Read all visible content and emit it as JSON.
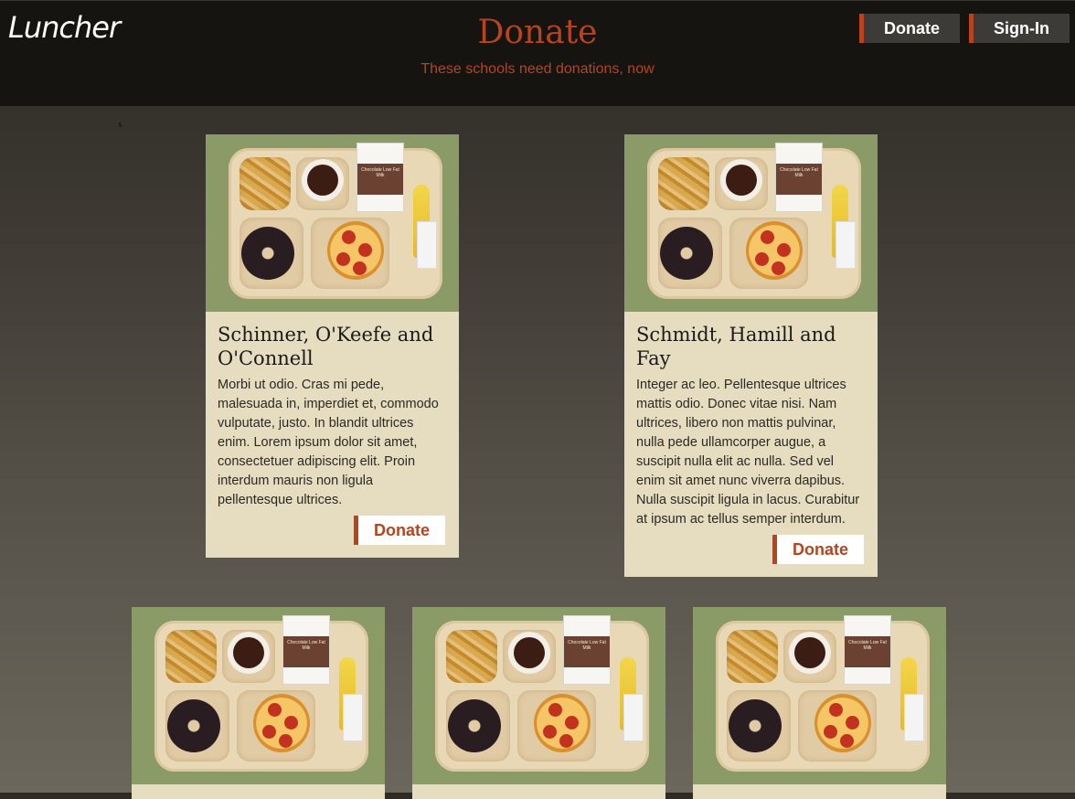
{
  "header": {
    "logo": "Luncher",
    "title": "Donate",
    "subtitle": "These schools need donations, now",
    "nav": {
      "donate_label": "Donate",
      "signin_label": "Sign-In"
    }
  },
  "stray_text": "s",
  "milk_label": "Chocolate Low Fat Milk",
  "colors": {
    "accent": "#b7441f",
    "card_bg": "#e6dcc0",
    "image_bg": "#8a9b67",
    "topbar": "#161410"
  },
  "schools": [
    {
      "name": "Schinner, O'Keefe and O'Connell",
      "description": "Morbi ut odio. Cras mi pede, malesuada in, imperdiet et, commodo vulputate, justo. In blandit ultrices enim. Lorem ipsum dolor sit amet, consectetuer adipiscing elit. Proin interdum mauris non ligula pellentesque ultrices.",
      "button_label": "Donate"
    },
    {
      "name": "Schmidt, Hamill and Fay",
      "description": "Integer ac leo. Pellentesque ultrices mattis odio. Donec vitae nisi. Nam ultrices, libero non mattis pulvinar, nulla pede ullamcorper augue, a suscipit nulla elit ac nulla. Sed vel enim sit amet nunc viverra dapibus. Nulla suscipit ligula in lacus. Curabitur at ipsum ac tellus semper interdum.",
      "button_label": "Donate"
    }
  ]
}
